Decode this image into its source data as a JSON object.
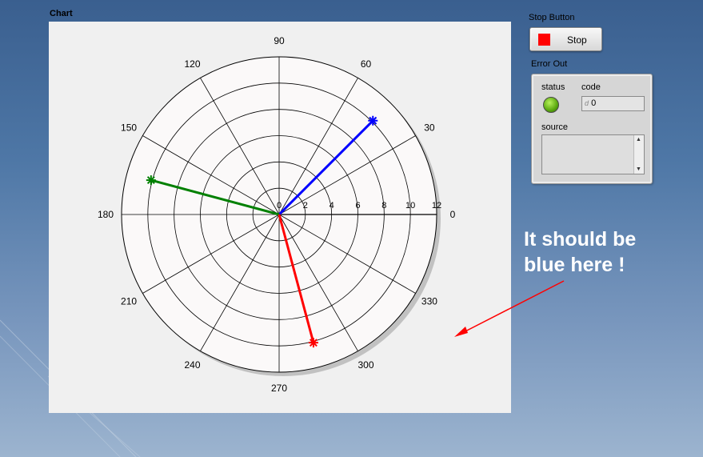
{
  "chart": {
    "title": "Chart",
    "angle_labels": [
      {
        "deg": 0,
        "text": "0"
      },
      {
        "deg": 30,
        "text": "30"
      },
      {
        "deg": 60,
        "text": "60"
      },
      {
        "deg": 90,
        "text": "90"
      },
      {
        "deg": 120,
        "text": "120"
      },
      {
        "deg": 150,
        "text": "150"
      },
      {
        "deg": 180,
        "text": "180"
      },
      {
        "deg": 210,
        "text": "210"
      },
      {
        "deg": 240,
        "text": "240"
      },
      {
        "deg": 270,
        "text": "270"
      },
      {
        "deg": 300,
        "text": "300"
      },
      {
        "deg": 330,
        "text": "330"
      }
    ],
    "radial_ticks": [
      "0",
      "2",
      "4",
      "6",
      "8",
      "10",
      "12"
    ]
  },
  "chart_data": {
    "type": "scatter",
    "subtype": "polar",
    "r_range": [
      0,
      12
    ],
    "angle_unit": "degrees",
    "grid": true,
    "series": [
      {
        "color": "#0000ff",
        "angle": 45,
        "r": 10.1
      },
      {
        "color": "#008000",
        "angle": 165,
        "r": 10.1
      },
      {
        "color": "#ff0000",
        "angle": 285,
        "r": 10.1
      }
    ]
  },
  "stop": {
    "title": "Stop Button",
    "label": "Stop"
  },
  "error_out": {
    "title": "Error Out",
    "status_label": "status",
    "code_label": "code",
    "code_prefix": "d",
    "code_value": "0",
    "source_label": "source",
    "source_value": "",
    "status_color": "#5aa80e"
  },
  "annotation": {
    "line1": "It should be",
    "line2": "blue here !",
    "arrow_color": "#ff0000"
  }
}
